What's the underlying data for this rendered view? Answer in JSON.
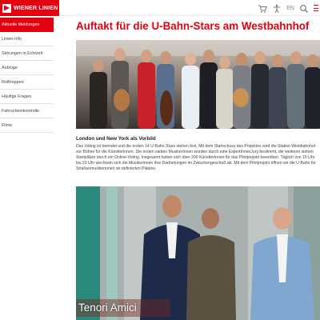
{
  "header": {
    "logo_text": "WIENER LINIEN",
    "cart_icon": "cart-icon",
    "accessibility_icon": "accessibility-icon",
    "language": "EN",
    "search_icon": "search-icon",
    "menu_icon": "menu-icon",
    "brand_color": "#e3000f"
  },
  "sidebar": {
    "items": [
      {
        "label": "Aktuelle Meldungen",
        "active": true
      },
      {
        "label": "Linien-Info",
        "active": false
      },
      {
        "label": "Störungen in Echtzeit",
        "active": false
      },
      {
        "label": "Aufzüge",
        "active": false
      },
      {
        "label": "Rolltreppen",
        "active": false
      },
      {
        "label": "Häufige Fragen",
        "active": false
      },
      {
        "label": "Fahrscheinkontrolle",
        "active": false
      },
      {
        "label": "Filme",
        "active": false
      }
    ]
  },
  "main": {
    "title": "Auftakt für die U-Bahn-Stars am Westbahnhof",
    "subheading": "London und New York als Vorbild",
    "body": "Das Voting ist beendet und die ersten 14 U-Bahn-Stars stehen fest. Mit dem Startschuss des Projektes wird die Station Westbahnhof zur Bühne für die KünstlerInnen. Die ersten sieben MusikerInnen wurden durch eine ExpertInnenJury bestimmt, die weiteren sieben Startplätze durch ein Online-Voting. Insgesamt hatten sich über 200 KünstlerInnen für das Pilotprojekt beworben. Täglich von 15 Uhr bis 23 Uhr wechseln sich die Musikerinnen ihre Darbietungen im Zwischengeschoß ab. Mit dem Pilotprojekt öffnen wir die U-Bahn für Straßenmusikerinnen an definierten Plätzen.",
    "photo_caption": "Tenori Amici"
  }
}
